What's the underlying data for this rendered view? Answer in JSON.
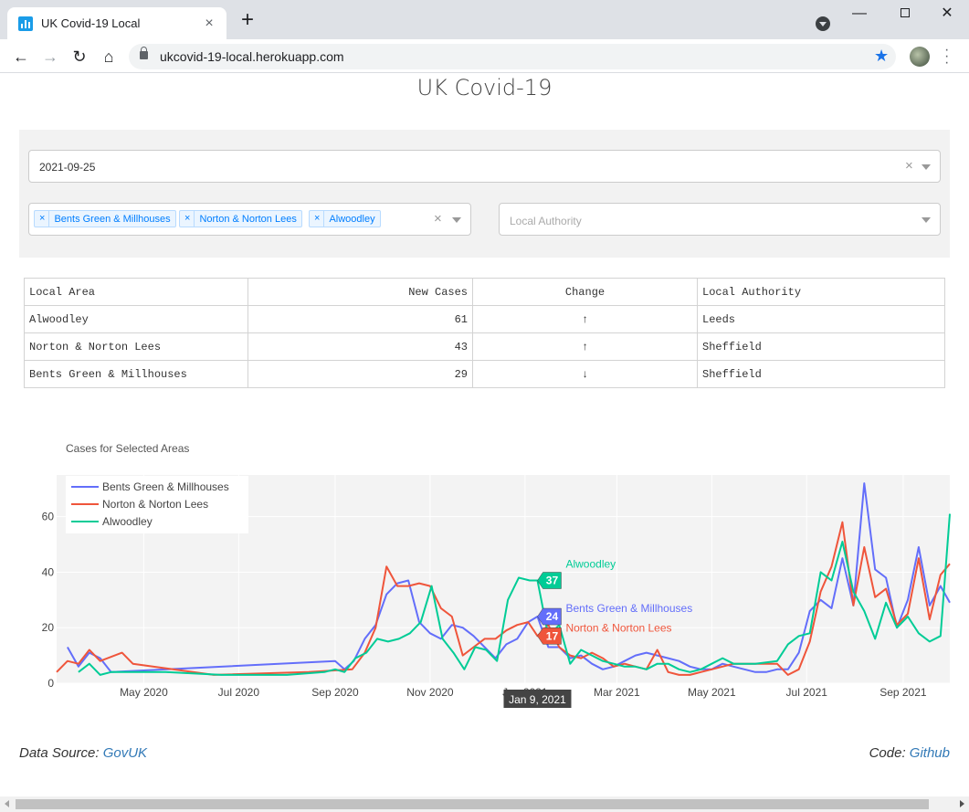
{
  "browser": {
    "tab_title": "UK Covid-19 Local",
    "url": "ukcovid-19-local.herokuapp.com"
  },
  "page": {
    "title": "UK Covid-19"
  },
  "controls": {
    "date_value": "2021-09-25",
    "selected_areas": [
      "Bents Green & Millhouses",
      "Norton & Norton Lees",
      "Alwoodley"
    ],
    "chip_remove": "×",
    "clear_symbol": "×",
    "authority_placeholder": "Local Authority"
  },
  "table": {
    "headers": [
      "Local Area",
      "New Cases",
      "Change",
      "Local Authority"
    ],
    "rows": [
      [
        "Alwoodley",
        "61",
        "↑",
        "Leeds"
      ],
      [
        "Norton & Norton Lees",
        "43",
        "↑",
        "Sheffield"
      ],
      [
        "Bents Green & Millhouses",
        "29",
        "↓",
        "Sheffield"
      ]
    ]
  },
  "chart_data": {
    "type": "line",
    "title": "Cases for Selected Areas",
    "x_tick_labels": [
      "May 2020",
      "Jul 2020",
      "Sep 2020",
      "Nov 2020",
      "Jan 2021",
      "Mar 2021",
      "May 2021",
      "Jul 2021",
      "Sep 2021"
    ],
    "y_ticks": [
      0,
      20,
      40,
      60
    ],
    "xlim": [
      "2020-03-06",
      "2021-10-01"
    ],
    "ylim": [
      0,
      75
    ],
    "grid": true,
    "legend_position": "top-left",
    "series": [
      {
        "name": "Bents Green & Millhouses",
        "color": "#636efa",
        "points": [
          [
            "2020-03-13",
            13
          ],
          [
            "2020-03-20",
            6
          ],
          [
            "2020-03-27",
            11
          ],
          [
            "2020-04-03",
            9
          ],
          [
            "2020-04-10",
            4
          ],
          [
            "2020-09-01",
            8
          ],
          [
            "2020-09-07",
            5
          ],
          [
            "2020-09-13",
            8
          ],
          [
            "2020-09-20",
            16
          ],
          [
            "2020-09-27",
            21
          ],
          [
            "2020-10-04",
            32
          ],
          [
            "2020-10-11",
            36
          ],
          [
            "2020-10-18",
            37
          ],
          [
            "2020-10-25",
            22
          ],
          [
            "2020-11-01",
            18
          ],
          [
            "2020-11-08",
            16
          ],
          [
            "2020-11-15",
            21
          ],
          [
            "2020-11-22",
            20
          ],
          [
            "2020-11-29",
            17
          ],
          [
            "2020-12-06",
            13
          ],
          [
            "2020-12-13",
            9
          ],
          [
            "2020-12-20",
            14
          ],
          [
            "2020-12-27",
            16
          ],
          [
            "2021-01-03",
            22
          ],
          [
            "2021-01-09",
            24
          ],
          [
            "2021-01-16",
            13
          ],
          [
            "2021-01-23",
            13
          ],
          [
            "2021-01-30",
            9
          ],
          [
            "2021-02-06",
            10
          ],
          [
            "2021-02-13",
            7
          ],
          [
            "2021-02-20",
            5
          ],
          [
            "2021-02-27",
            6
          ],
          [
            "2021-03-06",
            8
          ],
          [
            "2021-03-13",
            10
          ],
          [
            "2021-03-20",
            11
          ],
          [
            "2021-03-27",
            10
          ],
          [
            "2021-04-03",
            9
          ],
          [
            "2021-04-10",
            8
          ],
          [
            "2021-04-17",
            6
          ],
          [
            "2021-04-24",
            5
          ],
          [
            "2021-05-01",
            5
          ],
          [
            "2021-05-08",
            7
          ],
          [
            "2021-05-15",
            6
          ],
          [
            "2021-05-22",
            5
          ],
          [
            "2021-05-29",
            4
          ],
          [
            "2021-06-05",
            4
          ],
          [
            "2021-06-12",
            5
          ],
          [
            "2021-06-19",
            5
          ],
          [
            "2021-06-26",
            11
          ],
          [
            "2021-07-03",
            26
          ],
          [
            "2021-07-10",
            30
          ],
          [
            "2021-07-17",
            27
          ],
          [
            "2021-07-24",
            45
          ],
          [
            "2021-07-31",
            28
          ],
          [
            "2021-08-07",
            72
          ],
          [
            "2021-08-14",
            41
          ],
          [
            "2021-08-21",
            38
          ],
          [
            "2021-08-28",
            20
          ],
          [
            "2021-09-04",
            30
          ],
          [
            "2021-09-11",
            49
          ],
          [
            "2021-09-18",
            28
          ],
          [
            "2021-09-25",
            35
          ],
          [
            "2021-10-01",
            29
          ]
        ]
      },
      {
        "name": "Norton & Norton Lees",
        "color": "#ef553b",
        "points": [
          [
            "2020-03-06",
            4
          ],
          [
            "2020-03-13",
            8
          ],
          [
            "2020-03-20",
            7
          ],
          [
            "2020-03-27",
            12
          ],
          [
            "2020-04-03",
            8
          ],
          [
            "2020-04-17",
            11
          ],
          [
            "2020-04-24",
            7
          ],
          [
            "2020-06-15",
            3
          ],
          [
            "2020-08-15",
            4
          ],
          [
            "2020-09-12",
            5
          ],
          [
            "2020-09-20",
            11
          ],
          [
            "2020-09-27",
            20
          ],
          [
            "2020-10-04",
            42
          ],
          [
            "2020-10-11",
            35
          ],
          [
            "2020-10-18",
            35
          ],
          [
            "2020-10-25",
            36
          ],
          [
            "2020-11-01",
            35
          ],
          [
            "2020-11-08",
            27
          ],
          [
            "2020-11-15",
            24
          ],
          [
            "2020-11-22",
            10
          ],
          [
            "2020-11-29",
            13
          ],
          [
            "2020-12-06",
            16
          ],
          [
            "2020-12-13",
            16
          ],
          [
            "2020-12-20",
            19
          ],
          [
            "2020-12-27",
            21
          ],
          [
            "2021-01-03",
            22
          ],
          [
            "2021-01-09",
            17
          ],
          [
            "2021-01-16",
            21
          ],
          [
            "2021-01-23",
            13
          ],
          [
            "2021-01-30",
            10
          ],
          [
            "2021-02-06",
            9
          ],
          [
            "2021-02-13",
            11
          ],
          [
            "2021-02-20",
            9
          ],
          [
            "2021-02-27",
            6
          ],
          [
            "2021-03-06",
            7
          ],
          [
            "2021-03-13",
            6
          ],
          [
            "2021-03-20",
            5
          ],
          [
            "2021-03-27",
            12
          ],
          [
            "2021-04-03",
            4
          ],
          [
            "2021-04-10",
            3
          ],
          [
            "2021-04-17",
            3
          ],
          [
            "2021-04-24",
            4
          ],
          [
            "2021-05-01",
            5
          ],
          [
            "2021-05-15",
            7
          ],
          [
            "2021-06-01",
            7
          ],
          [
            "2021-06-12",
            7
          ],
          [
            "2021-06-19",
            3
          ],
          [
            "2021-06-26",
            5
          ],
          [
            "2021-07-03",
            15
          ],
          [
            "2021-07-10",
            33
          ],
          [
            "2021-07-17",
            42
          ],
          [
            "2021-07-24",
            58
          ],
          [
            "2021-07-31",
            28
          ],
          [
            "2021-08-07",
            49
          ],
          [
            "2021-08-14",
            31
          ],
          [
            "2021-08-21",
            34
          ],
          [
            "2021-08-28",
            21
          ],
          [
            "2021-09-04",
            25
          ],
          [
            "2021-09-11",
            45
          ],
          [
            "2021-09-18",
            23
          ],
          [
            "2021-09-25",
            39
          ],
          [
            "2021-10-01",
            43
          ]
        ]
      },
      {
        "name": "Alwoodley",
        "color": "#00cc96",
        "points": [
          [
            "2020-03-20",
            4
          ],
          [
            "2020-03-27",
            7
          ],
          [
            "2020-04-03",
            3
          ],
          [
            "2020-04-10",
            4
          ],
          [
            "2020-05-15",
            4
          ],
          [
            "2020-06-20",
            3
          ],
          [
            "2020-08-01",
            3
          ],
          [
            "2020-08-25",
            4
          ],
          [
            "2020-09-01",
            5
          ],
          [
            "2020-09-07",
            4
          ],
          [
            "2020-09-14",
            9
          ],
          [
            "2020-09-21",
            11
          ],
          [
            "2020-09-28",
            16
          ],
          [
            "2020-10-05",
            15
          ],
          [
            "2020-10-12",
            16
          ],
          [
            "2020-10-19",
            18
          ],
          [
            "2020-10-26",
            22
          ],
          [
            "2020-11-02",
            35
          ],
          [
            "2020-11-09",
            16
          ],
          [
            "2020-11-16",
            11
          ],
          [
            "2020-11-23",
            5
          ],
          [
            "2020-11-30",
            13
          ],
          [
            "2020-12-07",
            12
          ],
          [
            "2020-12-14",
            8
          ],
          [
            "2020-12-21",
            30
          ],
          [
            "2020-12-28",
            38
          ],
          [
            "2021-01-04",
            37
          ],
          [
            "2021-01-09",
            37
          ],
          [
            "2021-01-16",
            17
          ],
          [
            "2021-01-23",
            21
          ],
          [
            "2021-01-30",
            7
          ],
          [
            "2021-02-06",
            12
          ],
          [
            "2021-02-13",
            10
          ],
          [
            "2021-02-20",
            8
          ],
          [
            "2021-02-27",
            7
          ],
          [
            "2021-03-06",
            6
          ],
          [
            "2021-03-13",
            6
          ],
          [
            "2021-03-20",
            5
          ],
          [
            "2021-03-27",
            7
          ],
          [
            "2021-04-03",
            7
          ],
          [
            "2021-04-10",
            5
          ],
          [
            "2021-04-17",
            4
          ],
          [
            "2021-04-24",
            5
          ],
          [
            "2021-05-01",
            7
          ],
          [
            "2021-05-08",
            9
          ],
          [
            "2021-05-15",
            7
          ],
          [
            "2021-05-29",
            7
          ],
          [
            "2021-06-12",
            8
          ],
          [
            "2021-06-19",
            14
          ],
          [
            "2021-06-26",
            17
          ],
          [
            "2021-07-03",
            18
          ],
          [
            "2021-07-10",
            40
          ],
          [
            "2021-07-17",
            37
          ],
          [
            "2021-07-24",
            51
          ],
          [
            "2021-07-31",
            33
          ],
          [
            "2021-08-07",
            26
          ],
          [
            "2021-08-14",
            16
          ],
          [
            "2021-08-21",
            29
          ],
          [
            "2021-08-28",
            20
          ],
          [
            "2021-09-04",
            24
          ],
          [
            "2021-09-11",
            18
          ],
          [
            "2021-09-18",
            15
          ],
          [
            "2021-09-25",
            17
          ],
          [
            "2021-10-01",
            61
          ]
        ]
      }
    ],
    "hover": {
      "date_label": "Jan 9, 2021",
      "labels": [
        {
          "series": "Alwoodley",
          "value": "37",
          "name": "Alwoodley"
        },
        {
          "series": "Bents Green & Millhouses",
          "value": "24",
          "name": "Bents Green & Millhouses"
        },
        {
          "series": "Norton & Norton Lees",
          "value": "17",
          "name": "Norton & Norton Lees"
        }
      ]
    }
  },
  "footer": {
    "source_prefix": "Data Source: ",
    "source_link": "GovUK",
    "code_prefix": "Code: ",
    "code_link": "Github"
  }
}
